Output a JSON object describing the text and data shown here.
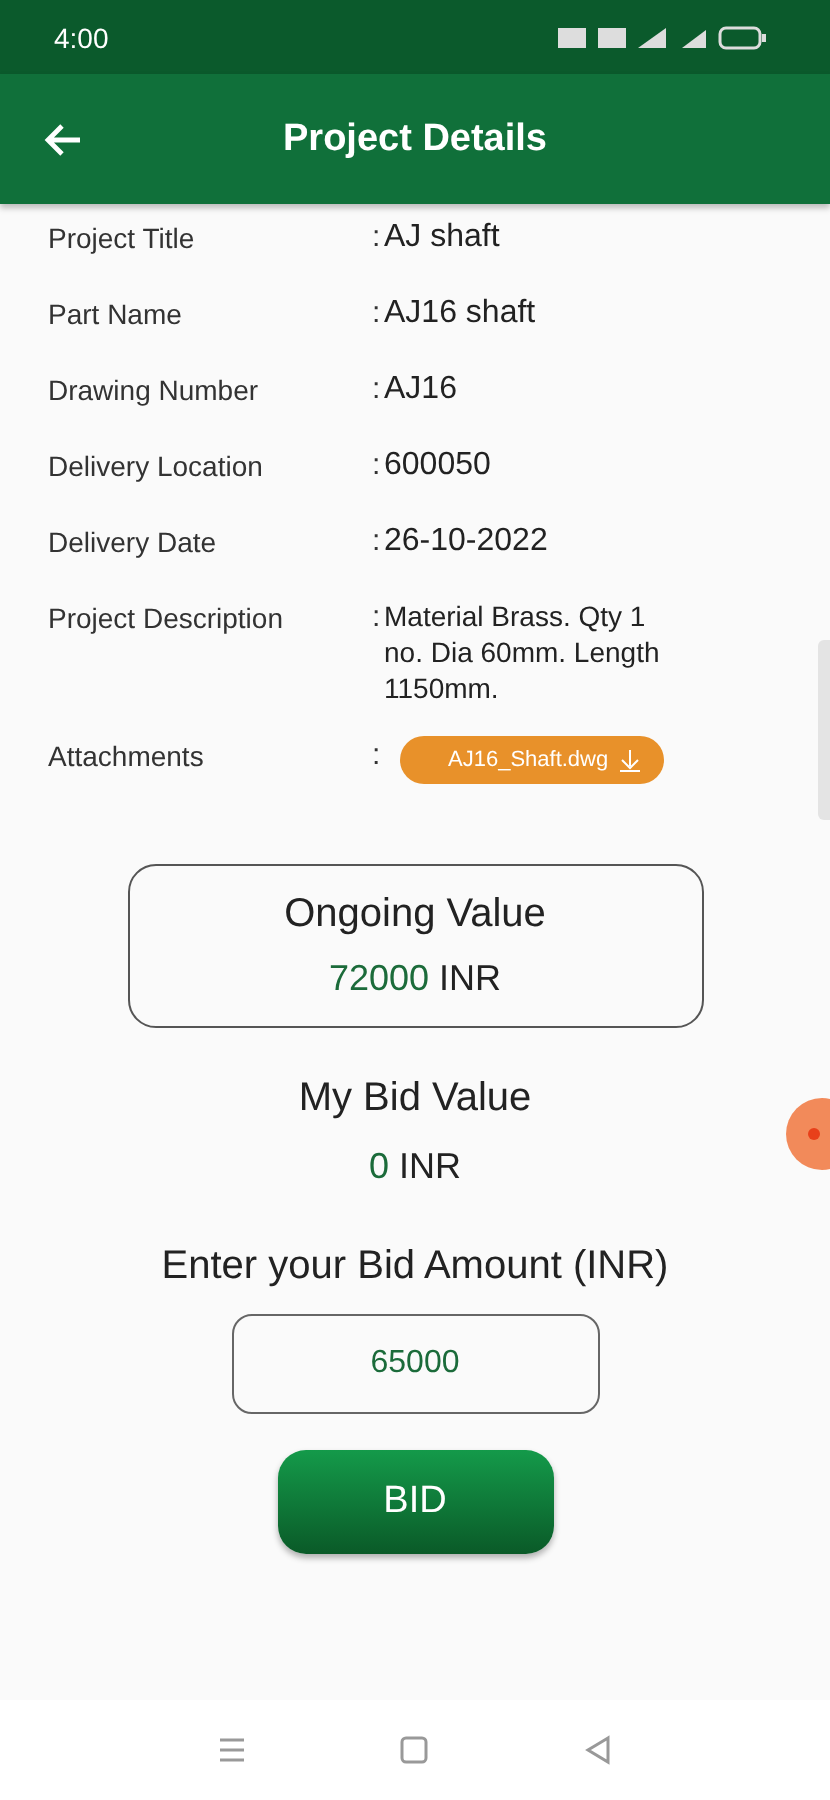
{
  "status_bar": {
    "time": "4:00"
  },
  "app_bar": {
    "title": "Project Details"
  },
  "details": [
    {
      "kind": "text",
      "label": "Project Title",
      "separator": ":",
      "value": "AJ shaft"
    },
    {
      "kind": "text",
      "label": "Part Name",
      "separator": ":",
      "value": "AJ16 shaft"
    },
    {
      "kind": "text",
      "label": "Drawing Number",
      "separator": ":",
      "value": "AJ16"
    },
    {
      "kind": "text",
      "label": "Delivery Location",
      "separator": ":",
      "value": "600050"
    },
    {
      "kind": "text",
      "label": "Delivery Date",
      "separator": ":",
      "value": "26-10-2022"
    },
    {
      "kind": "text",
      "label": "Project Description",
      "separator": ":",
      "value": "Material Brass. Qty 1 no. Dia 60mm. Length 1150mm."
    },
    {
      "kind": "attachment",
      "label": "Attachments",
      "separator": ":",
      "value": "AJ16_Shaft.dwg"
    }
  ],
  "ongoing": {
    "title": "Ongoing Value",
    "amount": "72000",
    "currency": "INR"
  },
  "my_bid": {
    "title": "My Bid Value",
    "amount": "0",
    "currency": "INR"
  },
  "bid_form": {
    "label": "Enter your Bid Amount (INR)",
    "value": "65000",
    "button": "BID"
  }
}
